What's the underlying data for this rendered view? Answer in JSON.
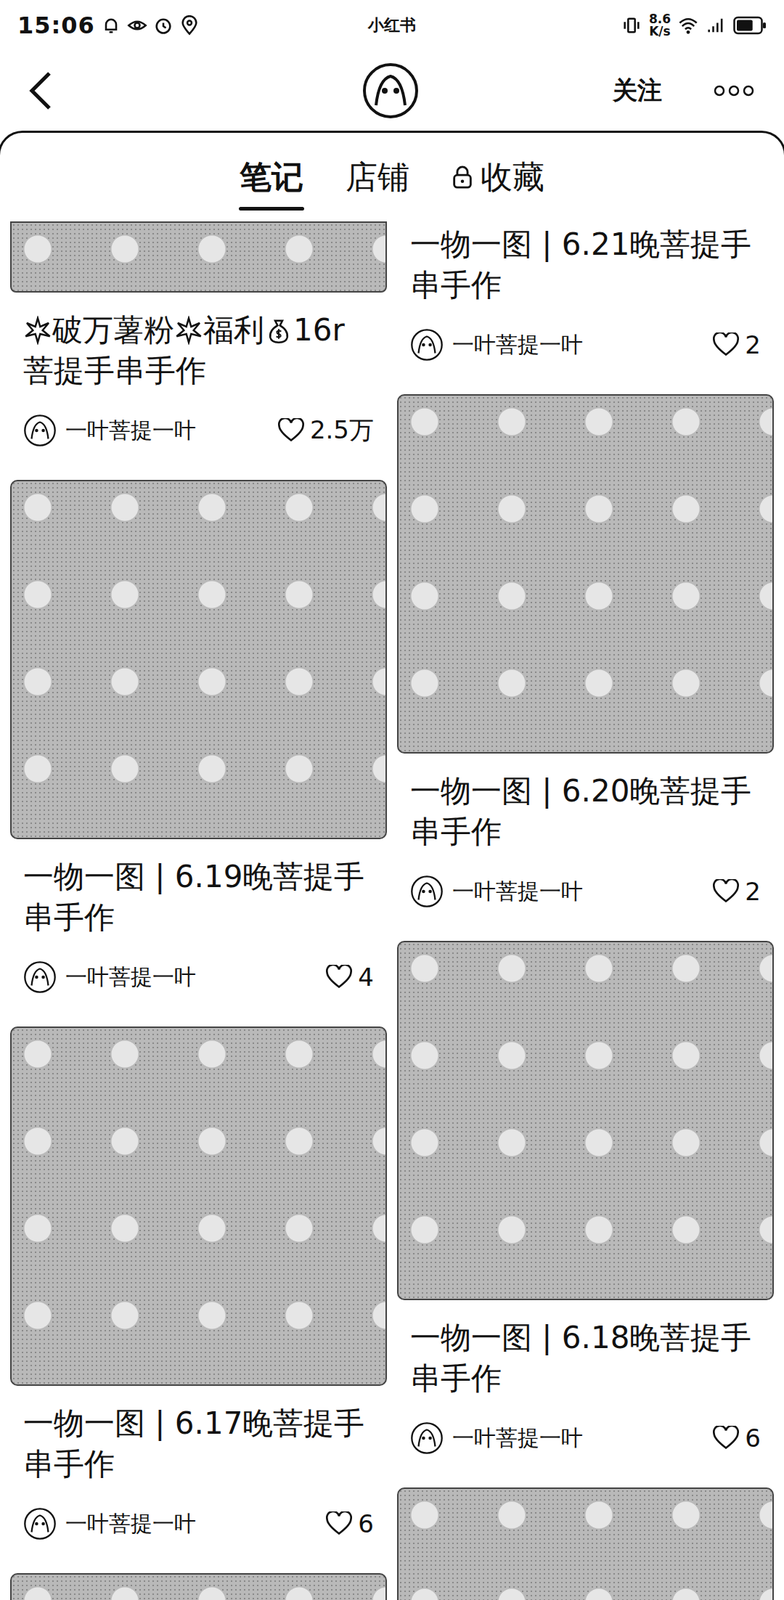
{
  "status_bar": {
    "time": "15:06",
    "app": "小红书",
    "speed": "8.6",
    "speed_unit": "K/s",
    "battery_level": 0.7
  },
  "nav": {
    "follow": "关注"
  },
  "tabs": [
    {
      "label": "笔记",
      "selected": true,
      "locked": false
    },
    {
      "label": "店铺",
      "selected": false,
      "locked": false
    },
    {
      "label": "收藏",
      "selected": false,
      "locked": true
    }
  ],
  "columns": [
    [
      {
        "kind": "cropped",
        "title": [
          {
            "kind": "sparkle"
          },
          {
            "kind": "text",
            "text": "破万薯粉"
          },
          {
            "kind": "sparkle"
          },
          {
            "kind": "text",
            "text": "福利"
          },
          {
            "kind": "money"
          },
          {
            "kind": "text",
            "text": "16r菩提手串手作"
          }
        ],
        "author": "一叶菩提一叶",
        "likes": "2.5万"
      },
      {
        "kind": "full",
        "title": [
          {
            "kind": "text",
            "text": "一物一图 | 6.19晚菩提手串手作"
          }
        ],
        "author": "一叶菩提一叶",
        "likes": "4"
      },
      {
        "kind": "full",
        "title": [
          {
            "kind": "text",
            "text": "一物一图 | 6.17晚菩提手串手作"
          }
        ],
        "author": "一叶菩提一叶",
        "likes": "6"
      },
      {
        "kind": "peek",
        "title": [],
        "author": "",
        "likes": ""
      }
    ],
    [
      {
        "kind": "caption",
        "title": [
          {
            "kind": "text",
            "text": "一物一图 | 6.21晚菩提手串手作"
          }
        ],
        "author": "一叶菩提一叶",
        "likes": "2"
      },
      {
        "kind": "full",
        "title": [
          {
            "kind": "text",
            "text": "一物一图 | 6.20晚菩提手串手作"
          }
        ],
        "author": "一叶菩提一叶",
        "likes": "2"
      },
      {
        "kind": "full",
        "title": [
          {
            "kind": "text",
            "text": "一物一图 | 6.18晚菩提手串手作"
          }
        ],
        "author": "一叶菩提一叶",
        "likes": "6"
      },
      {
        "kind": "peek",
        "title": [],
        "author": "",
        "likes": ""
      }
    ]
  ]
}
